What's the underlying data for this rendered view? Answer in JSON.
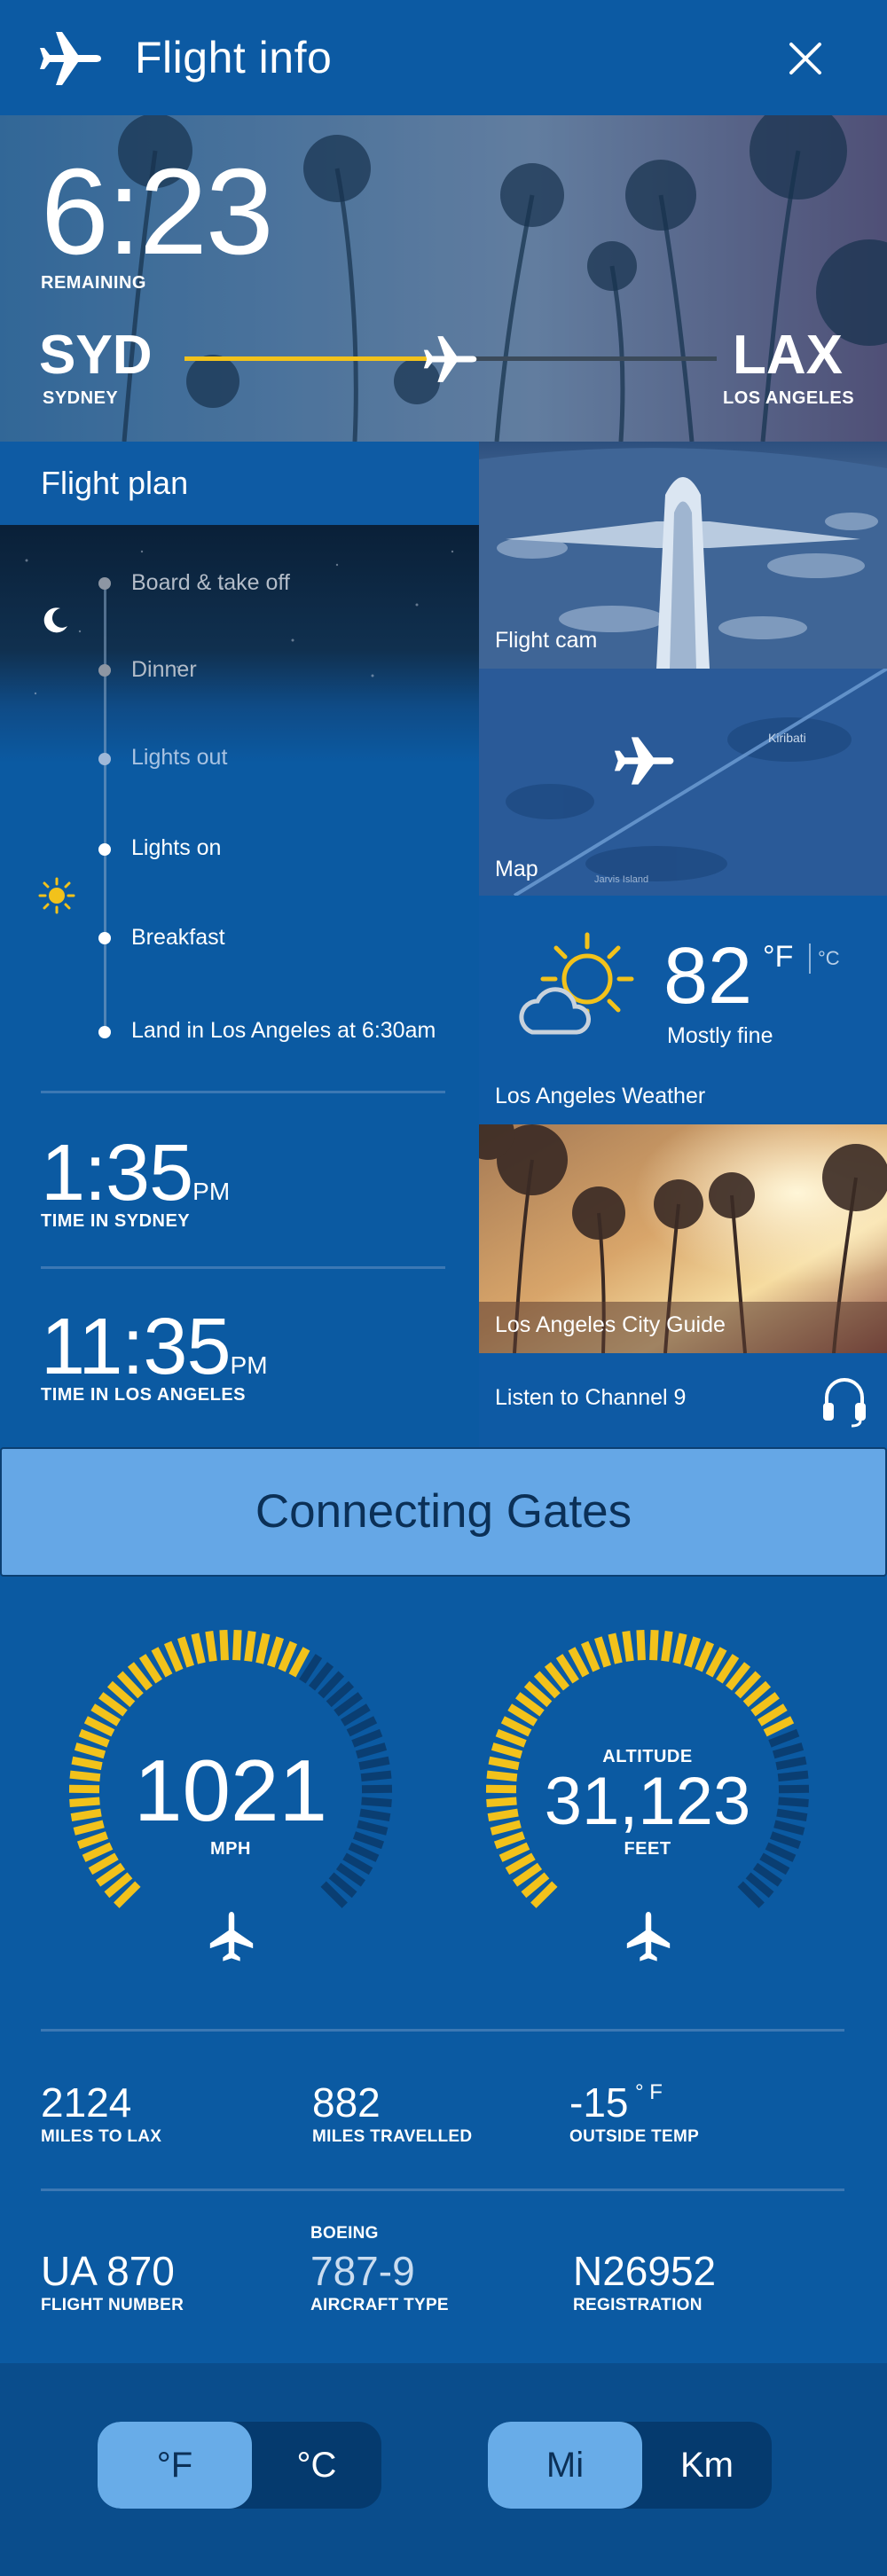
{
  "header": {
    "title": "Flight info"
  },
  "hero": {
    "time_remaining": "6:23",
    "remaining_label": "REMAINING",
    "origin_code": "SYD",
    "origin_name": "SYDNEY",
    "dest_code": "LAX",
    "dest_name": "LOS ANGELES",
    "progress": 0.5
  },
  "flight_plan": {
    "title": "Flight plan",
    "items": [
      {
        "label": "Board & take off"
      },
      {
        "label": "Dinner"
      },
      {
        "label": "Lights out"
      },
      {
        "label": "Lights on"
      },
      {
        "label": "Breakfast"
      },
      {
        "label": "Land in Los Angeles at 6:30am"
      }
    ]
  },
  "clocks": {
    "sydney_time": "1:35",
    "sydney_pm": "PM",
    "sydney_label": "TIME IN SYDNEY",
    "la_time": "11:35",
    "la_pm": "PM",
    "la_label": "TIME IN LOS ANGELES"
  },
  "tiles": {
    "flight_cam": "Flight cam",
    "map": "Map",
    "map_place_1": "Kiribati",
    "map_place_2": "Jarvis Island",
    "weather_temp": "82",
    "weather_unit_f": "°F",
    "weather_unit_c": "°C",
    "weather_desc": "Mostly fine",
    "weather_label": "Los Angeles Weather",
    "city_guide": "Los Angeles City Guide",
    "channel": "Listen to Channel 9"
  },
  "gates": {
    "label": "Connecting Gates"
  },
  "gauges": {
    "speed_value": "1021",
    "speed_unit": "MPH",
    "speed_fill": 0.62,
    "altitude_title": "ALTITUDE",
    "altitude_value": "31,123",
    "altitude_unit": "FEET",
    "altitude_fill": 0.75
  },
  "stats": {
    "miles_to_lax": "2124",
    "miles_to_lax_label": "MILES TO LAX",
    "miles_travelled": "882",
    "miles_travelled_label": "MILES TRAVELLED",
    "outside_temp": "-15",
    "outside_temp_unit": "° F",
    "outside_temp_label": "OUTSIDE TEMP",
    "flight_number": "UA 870",
    "flight_number_label": "FLIGHT NUMBER",
    "aircraft_make": "BOEING",
    "aircraft_type": "787-9",
    "aircraft_type_label": "AIRCRAFT TYPE",
    "registration": "N26952",
    "registration_label": "REGISTRATION"
  },
  "toggles": {
    "temp_f": "°F",
    "temp_c": "°C",
    "temp_selected": "°F",
    "dist_mi": "Mi",
    "dist_km": "Km",
    "dist_selected": "Mi"
  },
  "colors": {
    "accent": "#f2c21b",
    "background": "#0b5aa2",
    "toggle_selected": "#68ace8"
  }
}
